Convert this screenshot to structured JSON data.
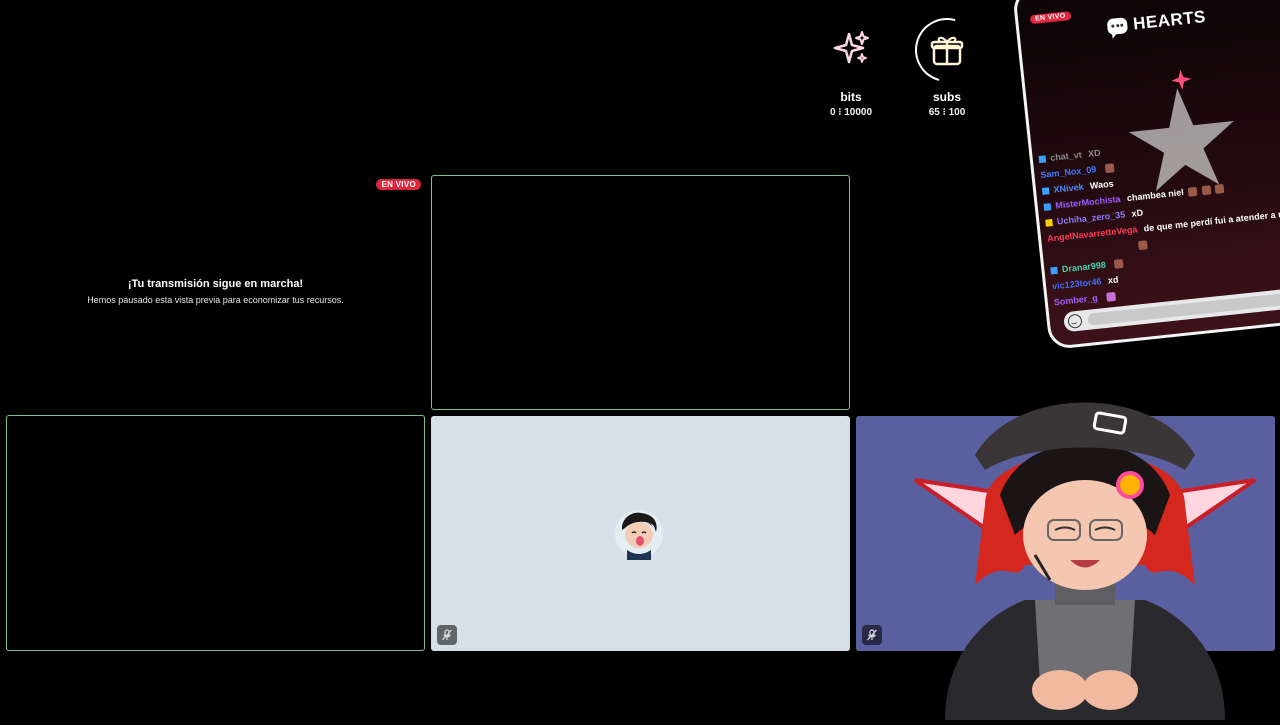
{
  "preview": {
    "live_badge": "EN VIVO",
    "title": "¡Tu transmisión sigue en marcha!",
    "subtitle": "Hemos pausado esta vista previa para economizar tus recursos."
  },
  "goals": [
    {
      "label": "bits",
      "progress": "0 ⁝ 10000",
      "icon": "sparkles-icon"
    },
    {
      "label": "subs",
      "progress": "65 ⁝ 100",
      "icon": "gift-icon"
    }
  ],
  "chat_overlay": {
    "live_badge": "EN VIVO",
    "title": "HEARTS",
    "messages": [
      {
        "user": "chat_vt",
        "text": "XD",
        "color": "#8a8a8a"
      },
      {
        "user": "Sam_Nox_09",
        "text": "",
        "color": "#3f7bff"
      },
      {
        "user": "XNivek",
        "text": "Waos",
        "color": "#4b8cff"
      },
      {
        "user": "MisterMochista",
        "text": "chambea niel",
        "color": "#9a5cff"
      },
      {
        "user": "Uchiha_zero_35",
        "text": "xD",
        "color": "#8f7bff"
      },
      {
        "user": "AngelNavarretteVega",
        "text": "de que me perdí fui a atender a mi amiga miga",
        "color": "#ff3a55"
      },
      {
        "user": "Dranar998",
        "text": "",
        "color": "#48d3b0"
      },
      {
        "user": "vic123tor46",
        "text": "xd",
        "color": "#3f6fff"
      },
      {
        "user": "Somber_g",
        "text": "",
        "color": "#a45cff"
      }
    ]
  },
  "colors": {
    "tile_border": "#7fbf8e",
    "tile_light": "#d5e0e8",
    "tile_blue": "#5a609f",
    "live_red": "#e0283d"
  }
}
